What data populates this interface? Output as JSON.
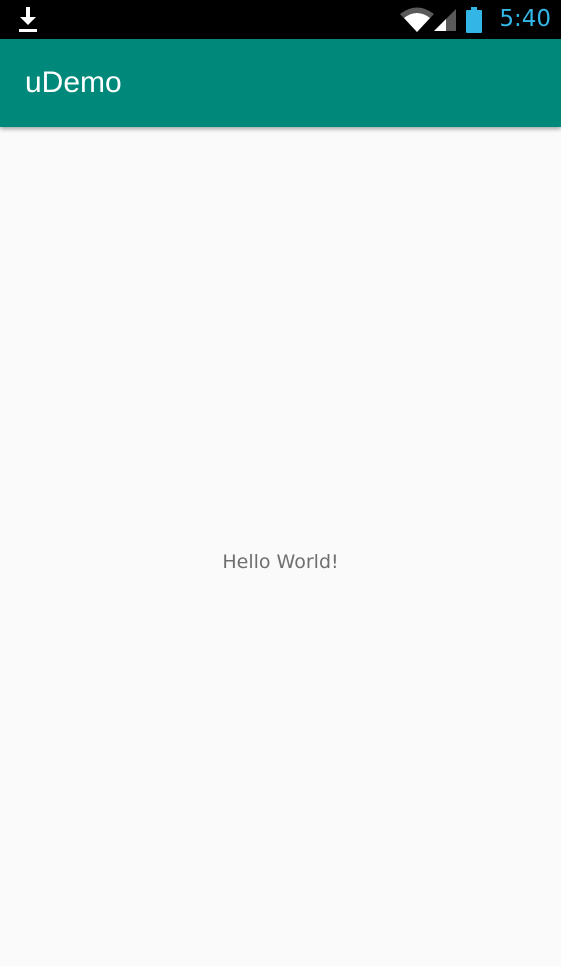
{
  "status_bar": {
    "left_icon": "download-icon",
    "wifi_icon": "wifi-icon",
    "signal_icon": "cell-signal-icon",
    "battery_icon": "battery-icon",
    "time": "5:40",
    "time_color": "#33b5e5"
  },
  "app_bar": {
    "title": "uDemo",
    "color": "#00897b"
  },
  "main": {
    "text": "Hello World!"
  }
}
